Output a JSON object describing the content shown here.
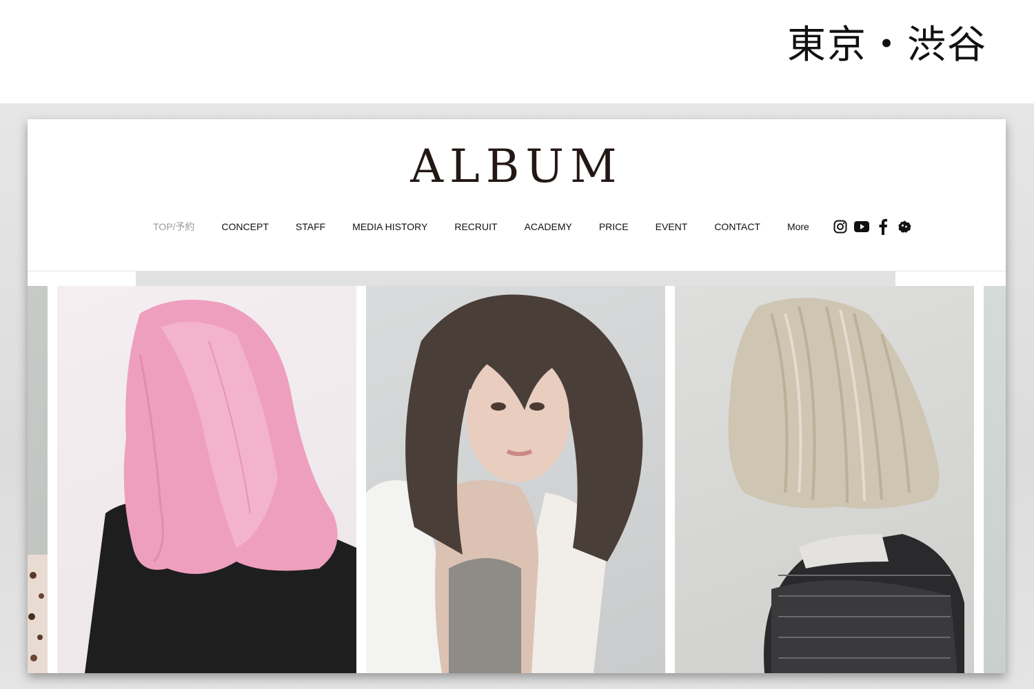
{
  "location_label": "東京・渋谷",
  "brand": {
    "logo_text": "ALBUM"
  },
  "nav": {
    "items": [
      {
        "label": "TOP/予約",
        "active": true
      },
      {
        "label": "CONCEPT"
      },
      {
        "label": "STAFF"
      },
      {
        "label": "MEDIA HISTORY"
      },
      {
        "label": "RECRUIT"
      },
      {
        "label": "ACADEMY"
      },
      {
        "label": "PRICE"
      },
      {
        "label": "EVENT"
      },
      {
        "label": "CONTACT"
      },
      {
        "label": "More"
      }
    ],
    "social_icons": [
      "instagram-icon",
      "youtube-icon",
      "facebook-icon",
      "hotpepper-icon"
    ]
  },
  "gallery": {
    "photos": [
      "pink-hair-back-view",
      "dark-brown-hair-portrait",
      "blonde-highlight-bob-back-view"
    ]
  },
  "colors": {
    "nav_active": "#9a9a9a",
    "logo": "#231815",
    "backdrop": "#e0e0e0"
  }
}
